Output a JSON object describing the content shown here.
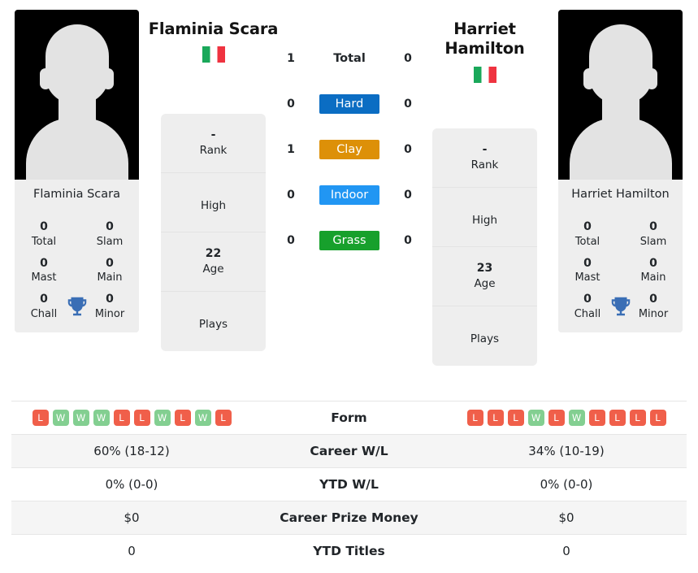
{
  "players": {
    "left": {
      "name": "Flaminia Scara",
      "photo_caption": "Flaminia Scara",
      "flag": "italy-flag",
      "rank": "-",
      "rank_label": "Rank",
      "high": "",
      "high_label": "High",
      "age": "22",
      "age_label": "Age",
      "plays": "",
      "plays_label": "Plays",
      "titles": {
        "total": "0",
        "total_label": "Total",
        "slam": "0",
        "slam_label": "Slam",
        "mast": "0",
        "mast_label": "Mast",
        "main": "0",
        "main_label": "Main",
        "chall": "0",
        "chall_label": "Chall",
        "minor": "0",
        "minor_label": "Minor"
      },
      "form": [
        "L",
        "W",
        "W",
        "W",
        "L",
        "L",
        "W",
        "L",
        "W",
        "L"
      ],
      "career_wl": "60% (18-12)",
      "ytd_wl": "0% (0-0)",
      "career_prize": "$0",
      "ytd_titles": "0"
    },
    "right": {
      "name": "Harriet Hamilton",
      "photo_caption": "Harriet Hamilton",
      "flag": "italy-flag",
      "rank": "-",
      "rank_label": "Rank",
      "high": "",
      "high_label": "High",
      "age": "23",
      "age_label": "Age",
      "plays": "",
      "plays_label": "Plays",
      "titles": {
        "total": "0",
        "total_label": "Total",
        "slam": "0",
        "slam_label": "Slam",
        "mast": "0",
        "mast_label": "Mast",
        "main": "0",
        "main_label": "Main",
        "chall": "0",
        "chall_label": "Chall",
        "minor": "0",
        "minor_label": "Minor"
      },
      "form": [
        "L",
        "L",
        "L",
        "W",
        "L",
        "W",
        "L",
        "L",
        "L",
        "L"
      ],
      "career_wl": "34% (10-19)",
      "ytd_wl": "0% (0-0)",
      "career_prize": "$0",
      "ytd_titles": "0"
    }
  },
  "surfaces": [
    {
      "key": "total",
      "label": "Total",
      "left": "1",
      "right": "0",
      "color": "transparent",
      "plain": true
    },
    {
      "key": "hard",
      "label": "Hard",
      "left": "0",
      "right": "0",
      "color": "#0b6dc3",
      "plain": false
    },
    {
      "key": "clay",
      "label": "Clay",
      "left": "1",
      "right": "0",
      "color": "#dd9008",
      "plain": false
    },
    {
      "key": "indoor",
      "label": "Indoor",
      "left": "0",
      "right": "0",
      "color": "#2196f3",
      "plain": false
    },
    {
      "key": "grass",
      "label": "Grass",
      "left": "0",
      "right": "0",
      "color": "#17a02c",
      "plain": false
    }
  ],
  "table_rows": [
    {
      "key": "form",
      "label": "Form",
      "type": "form",
      "shaded": false
    },
    {
      "key": "career_wl",
      "label": "Career W/L",
      "type": "text",
      "shaded": true
    },
    {
      "key": "ytd_wl",
      "label": "YTD W/L",
      "type": "text",
      "shaded": false
    },
    {
      "key": "career_prize",
      "label": "Career Prize Money",
      "type": "text",
      "shaded": true
    },
    {
      "key": "ytd_titles",
      "label": "YTD Titles",
      "type": "text",
      "shaded": false
    }
  ],
  "colors": {
    "win_badge": "#83cf91",
    "loss_badge": "#f05f4a",
    "trophy": "#3a6eb5",
    "card_bg": "#eeeeee",
    "row_shade": "#f5f5f5"
  }
}
